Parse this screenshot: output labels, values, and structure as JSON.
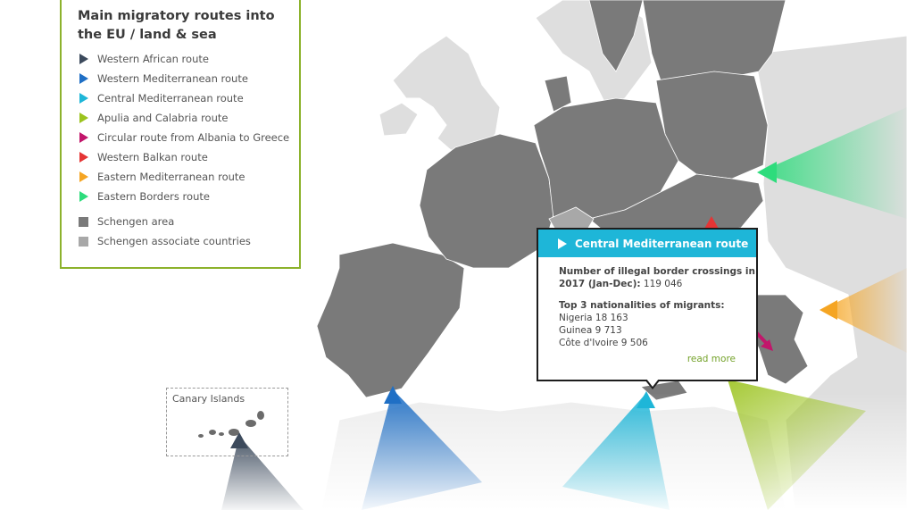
{
  "legend": {
    "title": "Main migratory routes into the EU / land & sea",
    "routes": [
      {
        "label": "Western African route",
        "color": "#3c4a5c"
      },
      {
        "label": "Western Mediterranean route",
        "color": "#1f6fc5"
      },
      {
        "label": "Central Mediterranean route",
        "color": "#1eb6d8"
      },
      {
        "label": "Apulia and Calabria route",
        "color": "#9bc31e"
      },
      {
        "label": "Circular route from Albania to Greece",
        "color": "#c2166b"
      },
      {
        "label": "Western Balkan route",
        "color": "#e53535"
      },
      {
        "label": "Eastern Mediterranean route",
        "color": "#f5a523"
      },
      {
        "label": "Eastern Borders route",
        "color": "#2ddc7c"
      }
    ],
    "areas": [
      {
        "label": "Schengen area",
        "color": "#7a7a7a"
      },
      {
        "label": "Schengen associate countries",
        "color": "#a8a8a8"
      }
    ]
  },
  "inset": {
    "label": "Canary Islands"
  },
  "popup": {
    "title": "Central Mediterranean route",
    "crossings_label": "Number of illegal border crossings in 2017 (Jan-Dec):",
    "crossings_value": "119 046",
    "nationalities_label": "Top 3 nationalities of migrants:",
    "nationalities": [
      "Nigeria 18 163",
      "Guinea 9 713",
      "Côte d'Ivoire 9 506"
    ],
    "read_more": "read more"
  },
  "colors": {
    "land_nonschengen": "#dedede",
    "schengen": "#7a7a7a",
    "associate": "#a8a8a8",
    "border": "#ffffff"
  }
}
